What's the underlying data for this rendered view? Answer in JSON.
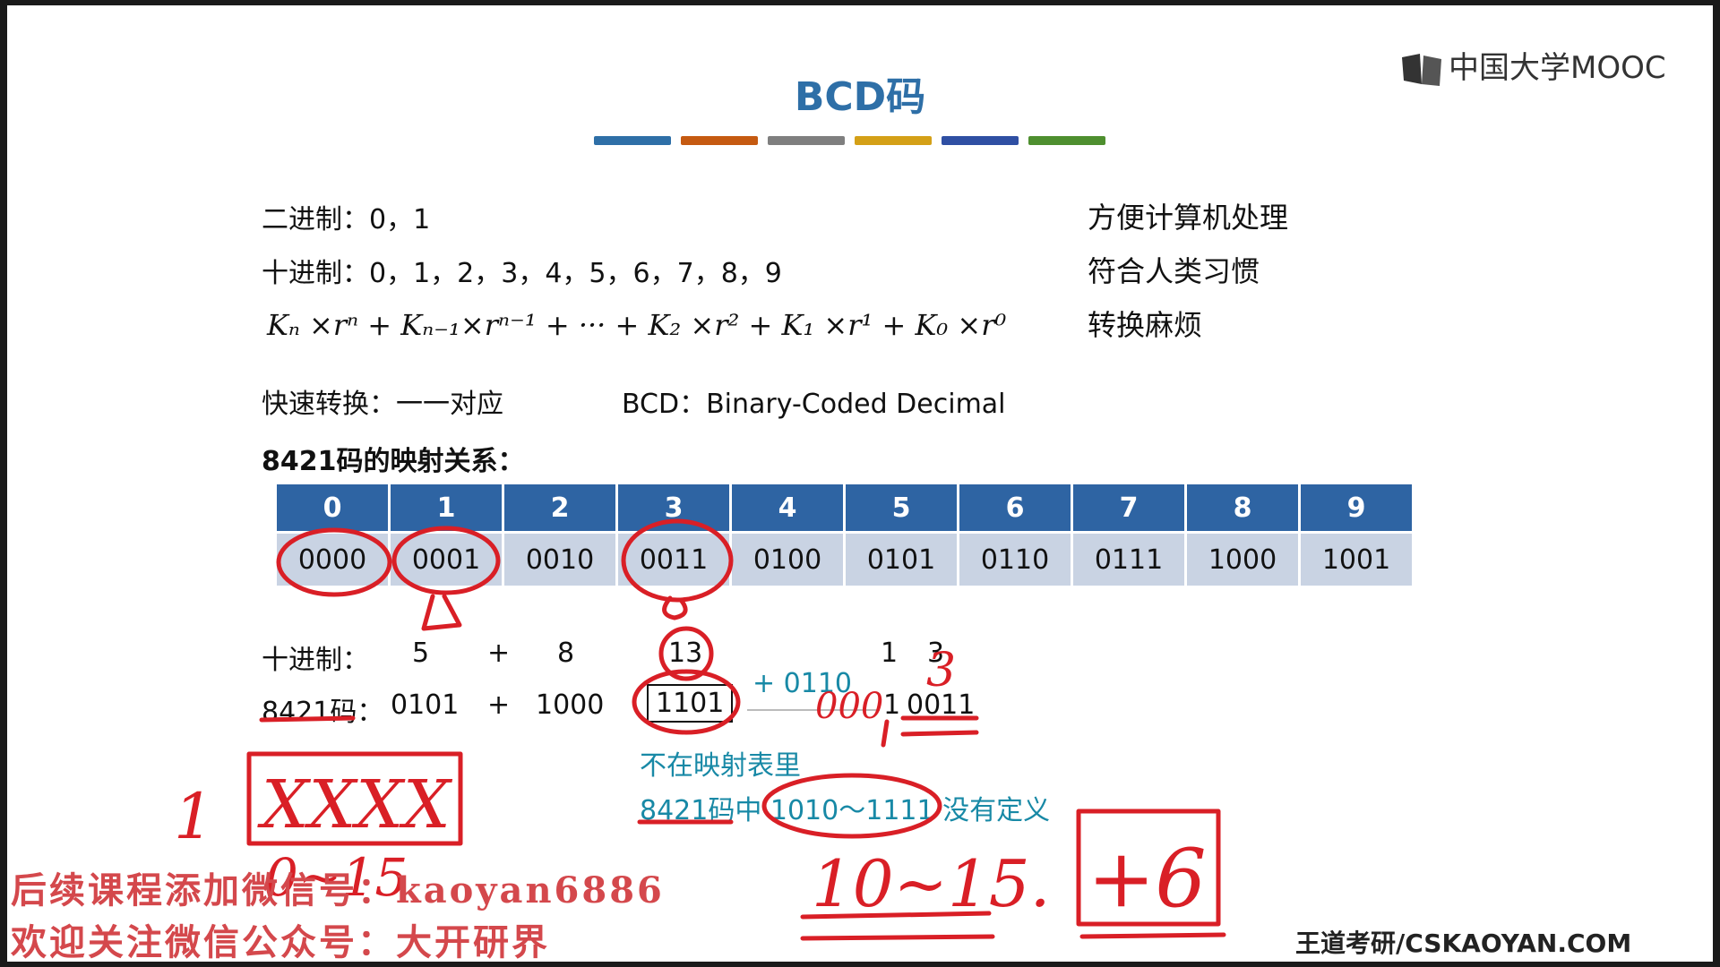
{
  "title": "BCD码",
  "logo_text": "中国大学MOOC",
  "accent_bars": [
    "#2e6fa7",
    "#c55a11",
    "#7f7f7f",
    "#d4a017",
    "#2f4fa3",
    "#4e8f2f"
  ],
  "lines": {
    "binary": "二进制：0，1",
    "decimal": "十进制：0，1，2，3，4，5，6，7，8，9",
    "fast_convert": "快速转换：一一对应",
    "bcd_def": "BCD：Binary-Coded Decimal",
    "mapping_label": "8421码的映射关系："
  },
  "formula": "Kₙ ×rⁿ + Kₙ₋₁×rⁿ⁻¹ + ··· + K₂ ×r² + K₁ ×r¹ + K₀ ×r⁰",
  "right_notes": [
    "方便计算机处理",
    "符合人类习惯",
    "转换麻烦"
  ],
  "mapping_table": {
    "digits": [
      "0",
      "1",
      "2",
      "3",
      "4",
      "5",
      "6",
      "7",
      "8",
      "9"
    ],
    "codes": [
      "0000",
      "0001",
      "0010",
      "0011",
      "0100",
      "0101",
      "0110",
      "0111",
      "1000",
      "1001"
    ]
  },
  "calc": {
    "dec_label": "十进制：",
    "dec_a": "5",
    "plus": "+",
    "dec_b": "8",
    "dec_sum": "13",
    "dec_res_1": "1",
    "dec_res_3": "3",
    "bcd_label": "8421码：",
    "bcd_a": "0101",
    "bcd_b": "1000",
    "bcd_sum": "1101",
    "add_six": "+ 0110",
    "bcd_res_high": "1",
    "bcd_res_low": "0011",
    "note1": "不在映射表里",
    "note2": "8421码中 1010～1111 没有定义"
  },
  "handwriting": {
    "xxxx": "XXXX",
    "one": "1",
    "range_left": "0~15",
    "range_right": "10~15.",
    "plus6": "+6",
    "zeros": "000",
    "three": "3"
  },
  "watermark": [
    "后续课程添加微信号：kaoyan6886",
    "欢迎关注微信公众号：大开研界"
  ],
  "footer": "王道考研/CSKAOYAN.COM",
  "ink_color": "#d91f26"
}
